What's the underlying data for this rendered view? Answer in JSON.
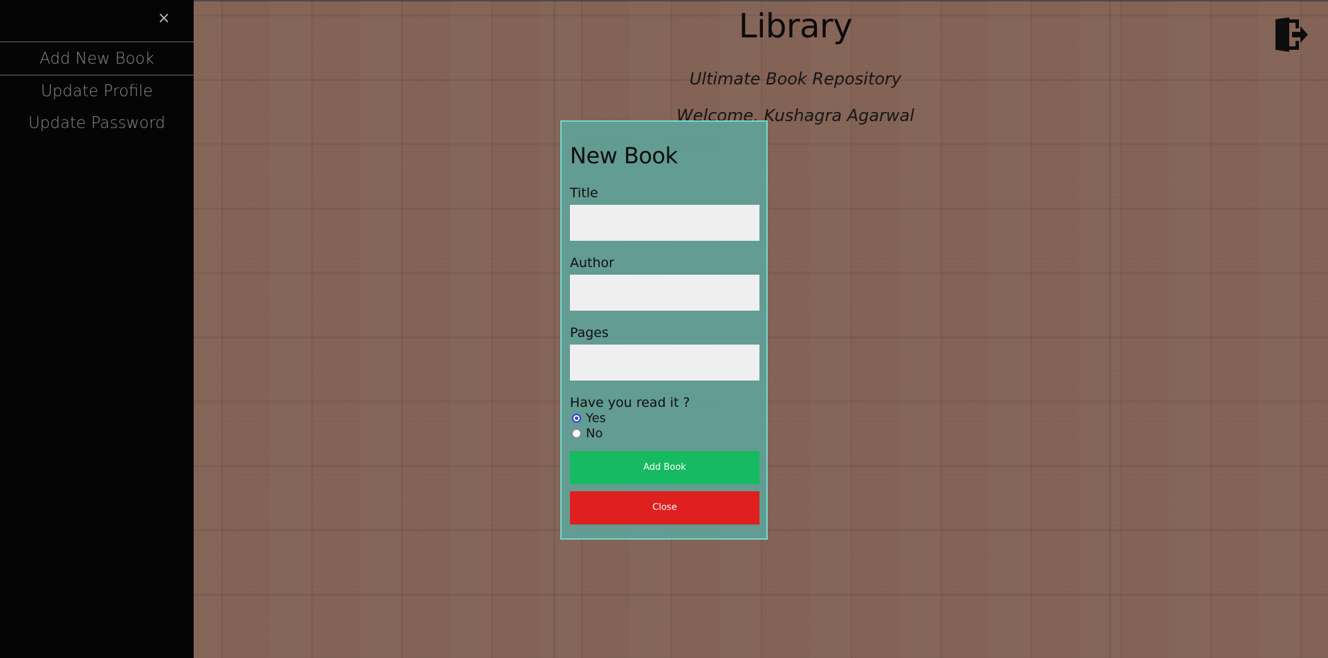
{
  "colors": {
    "sidebar_bg": "#050505",
    "modal_bg": "#5ca8a0",
    "modal_border": "#74d9cb",
    "add_button": "#16ba61",
    "close_button": "#e01f1f",
    "radio_accent": "#3b3bd6"
  },
  "sidebar": {
    "close_symbol": "×",
    "close_icon": "close-icon",
    "items": [
      {
        "label": "Add New Book",
        "active": true
      },
      {
        "label": "Update Profile",
        "active": false
      },
      {
        "label": "Update Password",
        "active": false
      }
    ]
  },
  "header": {
    "title": "Library",
    "subtitle": "Ultimate Book Repository",
    "welcome": "Welcome, Kushagra Agarwal",
    "logout_icon": "logout-icon"
  },
  "modal": {
    "title": "New Book",
    "fields": {
      "title_label": "Title",
      "title_value": "",
      "author_label": "Author",
      "author_value": "",
      "pages_label": "Pages",
      "pages_value": ""
    },
    "read_question": "Have you read it ?",
    "options": [
      {
        "label": "Yes",
        "checked": true
      },
      {
        "label": "No",
        "checked": false
      }
    ],
    "add_label": "Add Book",
    "close_label": "Close"
  }
}
